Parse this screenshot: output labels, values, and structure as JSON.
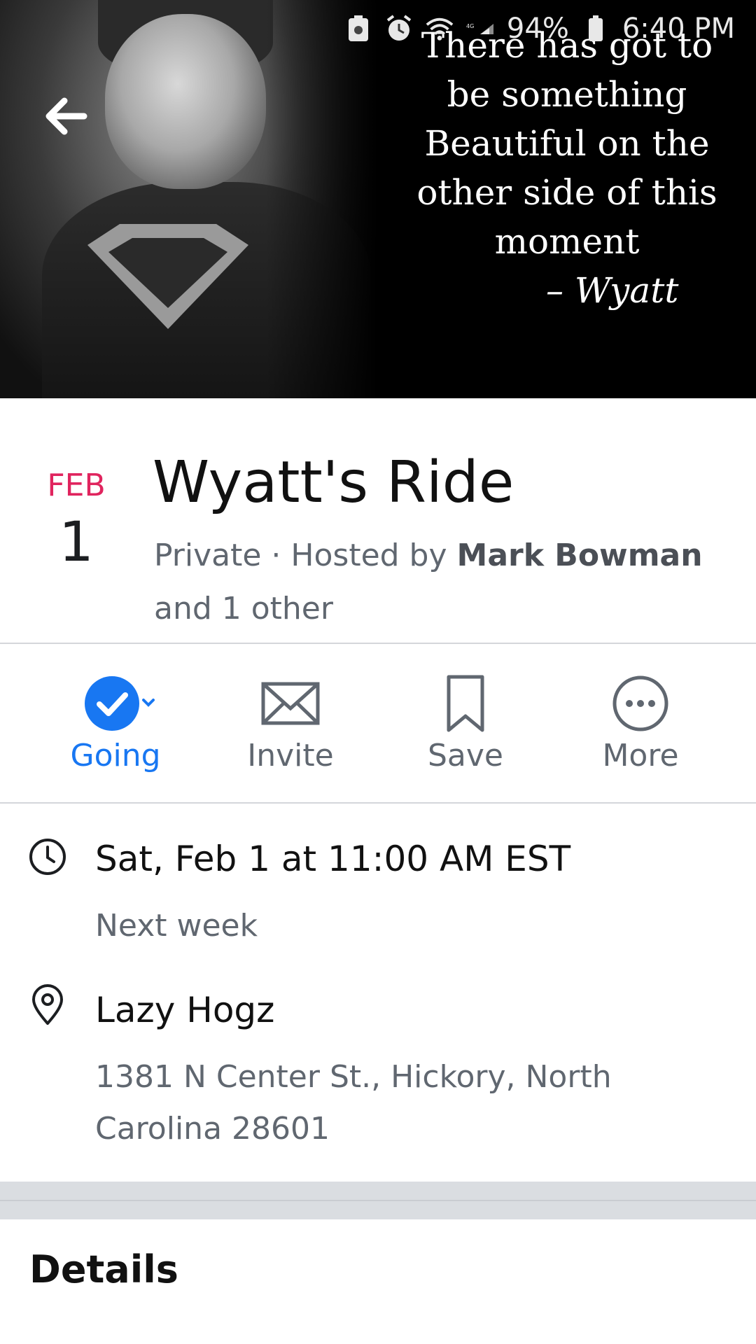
{
  "status_bar": {
    "battery": "94%",
    "time": "6:40 PM"
  },
  "cover": {
    "quote_lines": [
      "There has got to",
      "be something",
      "Beautiful on the",
      "other side of this",
      "moment"
    ],
    "quote_author": "– Wyatt"
  },
  "event": {
    "month": "FEB",
    "day": "1",
    "title": "Wyatt's Ride",
    "privacy": "Private",
    "hosted_prefix": "Hosted by",
    "host": "Mark Bowman",
    "others": "and 1 other"
  },
  "actions": {
    "going": "Going",
    "invite": "Invite",
    "save": "Save",
    "more": "More"
  },
  "info": {
    "datetime": "Sat, Feb 1 at 11:00 AM EST",
    "relative": "Next week",
    "venue": "Lazy Hogz",
    "address_line1": "1381 N Center St., Hickory, North",
    "address_line2": "Carolina 28601"
  },
  "sections": {
    "details": "Details"
  },
  "colors": {
    "accent": "#1877f2",
    "date_red": "#e0245e",
    "secondary_text": "#606770"
  }
}
